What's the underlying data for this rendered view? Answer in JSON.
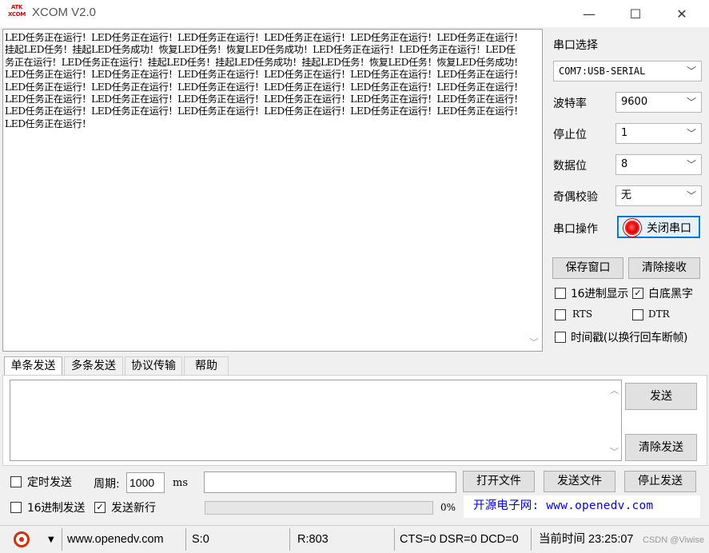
{
  "window": {
    "title": "XCOM V2.0",
    "logo_top": "ATK",
    "logo_bottom": "XCOM",
    "minimize_icon": "—",
    "maximize_icon": "☐",
    "close_icon": "✕"
  },
  "receive": {
    "text": "LED任务正在运行！LED任务正在运行！LED任务正在运行！LED任务正在运行！LED任务正在运行！LED任务正在运行！挂起LED任务！挂起LED任务成功！恢复LED任务！恢复LED任务成功！LED任务正在运行！LED任务正在运行！LED任务正在运行！LED任务正在运行！挂起LED任务！挂起LED任务成功！挂起LED任务！恢复LED任务！恢复LED任务成功！LED任务正在运行！LED任务正在运行！LED任务正在运行！LED任务正在运行！LED任务正在运行！LED任务正在运行！LED任务正在运行！LED任务正在运行！LED任务正在运行！LED任务正在运行！LED任务正在运行！LED任务正在运行！LED任务正在运行！LED任务正在运行！LED任务正在运行！LED任务正在运行！LED任务正在运行！LED任务正在运行！LED任务正在运行！LED任务正在运行！LED任务正在运行！LED任务正在运行！LED任务正在运行！LED任务正在运行！LED任务正在运行！"
  },
  "settings": {
    "port_label": "串口选择",
    "port_value": "COM7:USB-SERIAL",
    "baud_label": "波特率",
    "baud_value": "9600",
    "stop_label": "停止位",
    "stop_value": "1",
    "data_label": "数据位",
    "data_value": "8",
    "parity_label": "奇偶校验",
    "parity_value": "无",
    "op_label": "串口操作",
    "op_button": "关闭串口",
    "save_window": "保存窗口",
    "clear_recv": "清除接收",
    "hex_display": "16进制显示",
    "white_black": "白底黑字",
    "rts": "RTS",
    "dtr": "DTR",
    "timestamp": "时间戳(以换行回车断帧)"
  },
  "tabs": [
    "单条发送",
    "多条发送",
    "协议传输",
    "帮助"
  ],
  "send": {
    "send_button": "发送",
    "clear_send": "清除发送",
    "timed_send": "定时发送",
    "period_label": "周期:",
    "period_value": "1000",
    "period_unit": "ms",
    "open_file": "打开文件",
    "send_file": "发送文件",
    "stop_send": "停止发送",
    "hex_send": "16进制发送",
    "send_newline": "发送新行",
    "progress": "0%",
    "promo": "开源电子网: www.openedv.com"
  },
  "status": {
    "url": "www.openedv.com",
    "sent": "S:0",
    "received": "R:803",
    "lines": "CTS=0 DSR=0 DCD=0",
    "time": "当前时间 23:25:07",
    "watermark": "CSDN @Viwise"
  },
  "colors": {
    "accent": "#0078d7",
    "led": "#e00000",
    "link": "#0000ee"
  }
}
